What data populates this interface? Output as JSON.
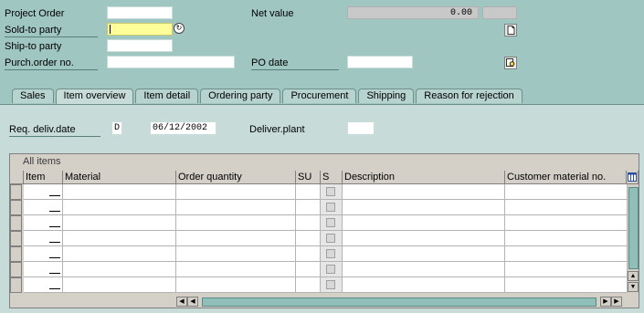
{
  "header": {
    "project_order_label": "Project Order",
    "sold_to_label": "Sold-to party",
    "ship_to_label": "Ship-to party",
    "purch_order_label": "Purch.order no.",
    "net_value_label": "Net value",
    "net_value": "0.00",
    "po_date_label": "PO date"
  },
  "tabs": [
    {
      "label": "Sales"
    },
    {
      "label": "Item overview"
    },
    {
      "label": "Item detail"
    },
    {
      "label": "Ordering party"
    },
    {
      "label": "Procurement"
    },
    {
      "label": "Shipping"
    },
    {
      "label": "Reason for rejection"
    }
  ],
  "overview": {
    "req_deliv_label": "Req. deliv.date",
    "date_type": "D",
    "date": "06/12/2002",
    "deliver_plant_label": "Deliver.plant"
  },
  "table": {
    "title": "All items",
    "columns": [
      "Item",
      "Material",
      "Order quantity",
      "SU",
      "S",
      "Description",
      "Customer material no."
    ]
  }
}
